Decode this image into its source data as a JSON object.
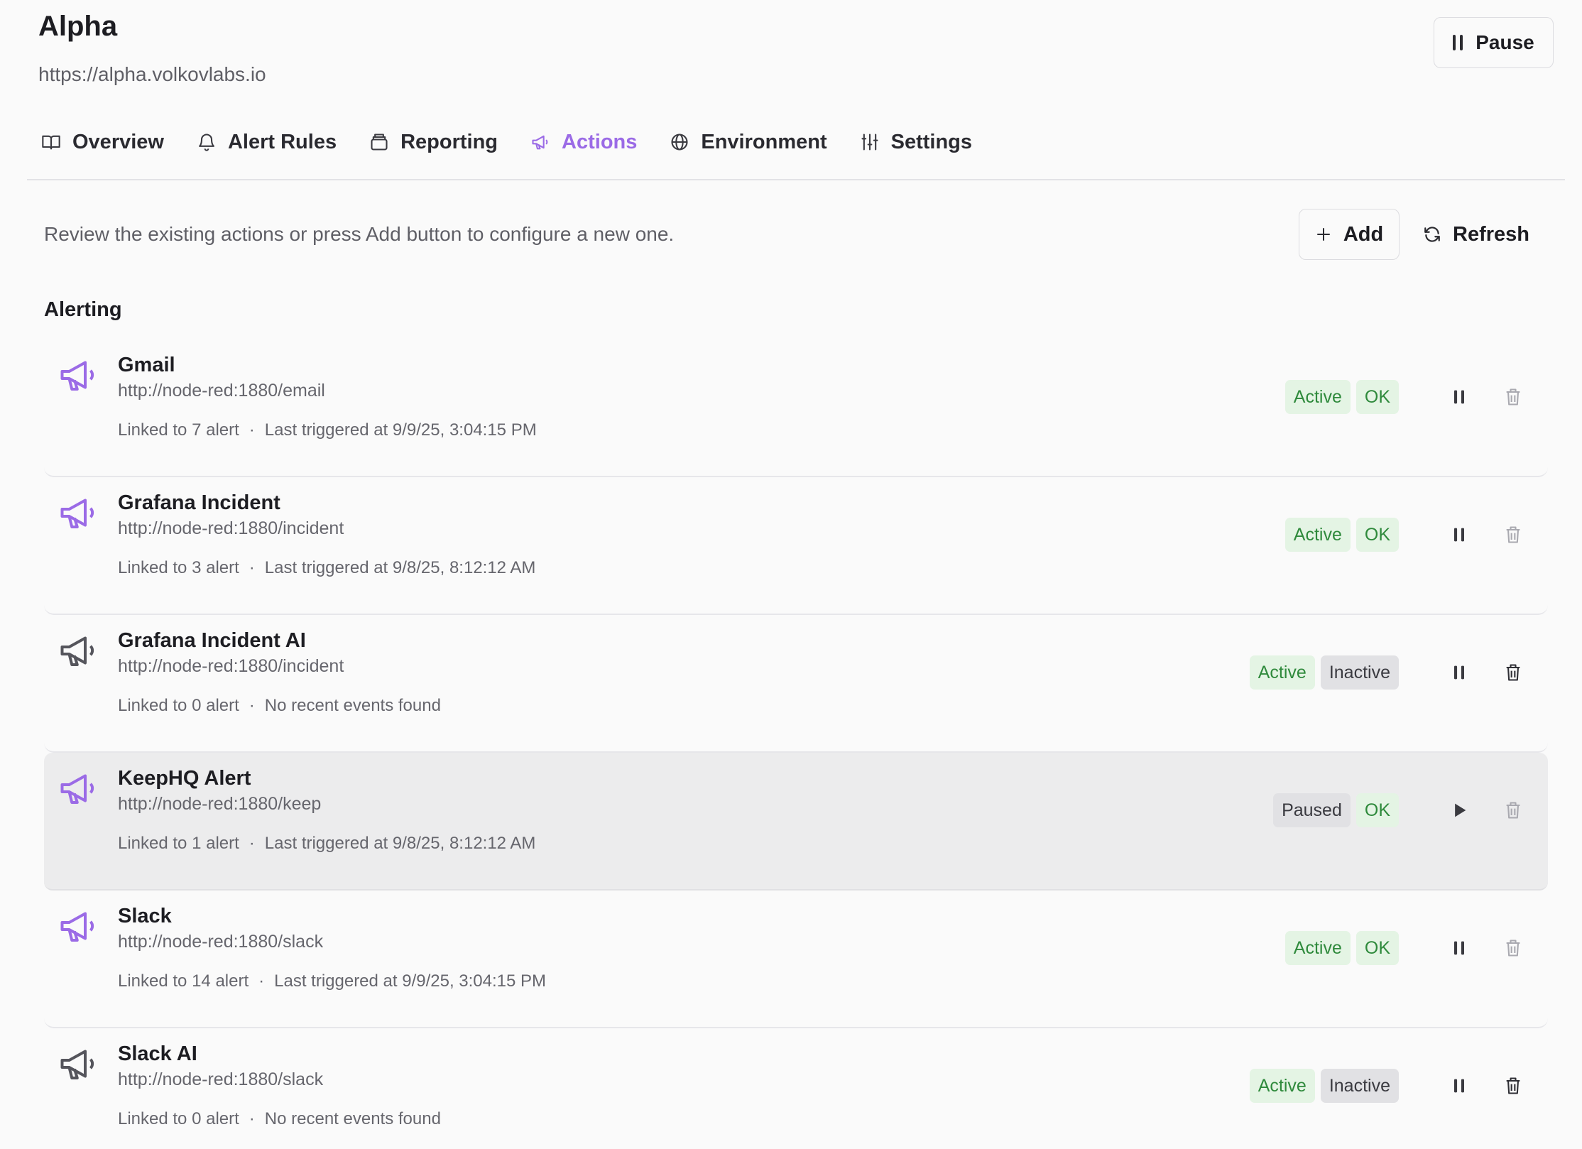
{
  "header": {
    "title": "Alpha",
    "url": "https://alpha.volkovlabs.io",
    "pause_label": "Pause"
  },
  "tabs": [
    {
      "label": "Overview",
      "icon": "book-open-icon",
      "active": false
    },
    {
      "label": "Alert Rules",
      "icon": "bell-icon",
      "active": false
    },
    {
      "label": "Reporting",
      "icon": "archive-icon",
      "active": false
    },
    {
      "label": "Actions",
      "icon": "megaphone-icon",
      "active": true
    },
    {
      "label": "Environment",
      "icon": "globe-icon",
      "active": false
    },
    {
      "label": "Settings",
      "icon": "sliders-icon",
      "active": false
    }
  ],
  "toolbar": {
    "intro": "Review the existing actions or press Add button to configure a new one.",
    "add_label": "Add",
    "refresh_label": "Refresh"
  },
  "section": {
    "title": "Alerting"
  },
  "actions": [
    {
      "name": "Gmail",
      "url": "http://node-red:1880/email",
      "linked": "Linked to 7 alert",
      "last": "Last triggered at 9/9/25, 3:04:15 PM",
      "state": "Active",
      "health": "OK",
      "paused": false
    },
    {
      "name": "Grafana Incident",
      "url": "http://node-red:1880/incident",
      "linked": "Linked to 3 alert",
      "last": "Last triggered at 9/8/25, 8:12:12 AM",
      "state": "Active",
      "health": "OK",
      "paused": false
    },
    {
      "name": "Grafana Incident AI",
      "url": "http://node-red:1880/incident",
      "linked": "Linked to 0 alert",
      "last": "No recent events found",
      "state": "Active",
      "health": "Inactive",
      "paused": false
    },
    {
      "name": "KeepHQ Alert",
      "url": "http://node-red:1880/keep",
      "linked": "Linked to 1 alert",
      "last": "Last triggered at 9/8/25, 8:12:12 AM",
      "state": "Paused",
      "health": "OK",
      "paused": true
    },
    {
      "name": "Slack",
      "url": "http://node-red:1880/slack",
      "linked": "Linked to 14 alert",
      "last": "Last triggered at 9/9/25, 3:04:15 PM",
      "state": "Active",
      "health": "OK",
      "paused": false
    },
    {
      "name": "Slack AI",
      "url": "http://node-red:1880/slack",
      "linked": "Linked to 0 alert",
      "last": "No recent events found",
      "state": "Active",
      "health": "Inactive",
      "paused": false
    }
  ],
  "colors": {
    "accent": "#9b6be6",
    "ok_bg": "#e4f4e4",
    "ok_text": "#2f8a3c",
    "neutral_bg": "#e1e1e4"
  }
}
